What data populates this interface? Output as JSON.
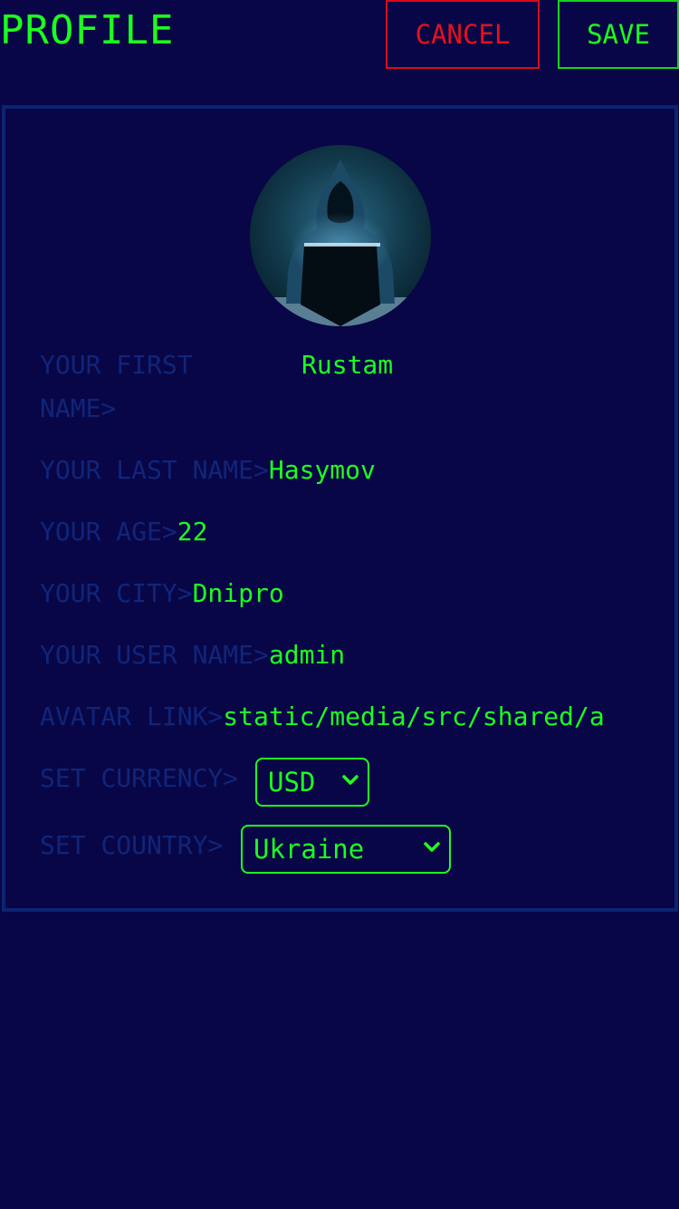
{
  "header": {
    "title": "PROFILE",
    "cancel_label": "CANCEL",
    "save_label": "SAVE"
  },
  "colors": {
    "background": "#080646",
    "accent_green": "#1dff1d",
    "cancel_red": "#e5101c",
    "label_blue": "#10257a",
    "card_border": "#0c2472"
  },
  "profile": {
    "avatar_icon": "hooded-hacker-avatar",
    "first_name": {
      "label_line1": "YOUR FIRST",
      "label_line2": "NAME>",
      "value": "Rustam"
    },
    "last_name": {
      "label": "YOUR LAST NAME>",
      "value": "Hasymov"
    },
    "age": {
      "label": "YOUR AGE>",
      "value": "22"
    },
    "city": {
      "label": "YOUR CITY>",
      "value": "Dnipro"
    },
    "user_name": {
      "label": "YOUR USER NAME>",
      "value": "admin"
    },
    "avatar_link": {
      "label": "AVATAR LINK>",
      "value": "static/media/src/shared/a"
    },
    "currency": {
      "label": "SET CURRENCY>",
      "selected": "USD"
    },
    "country": {
      "label": "SET COUNTRY>",
      "selected": "Ukraine"
    }
  }
}
